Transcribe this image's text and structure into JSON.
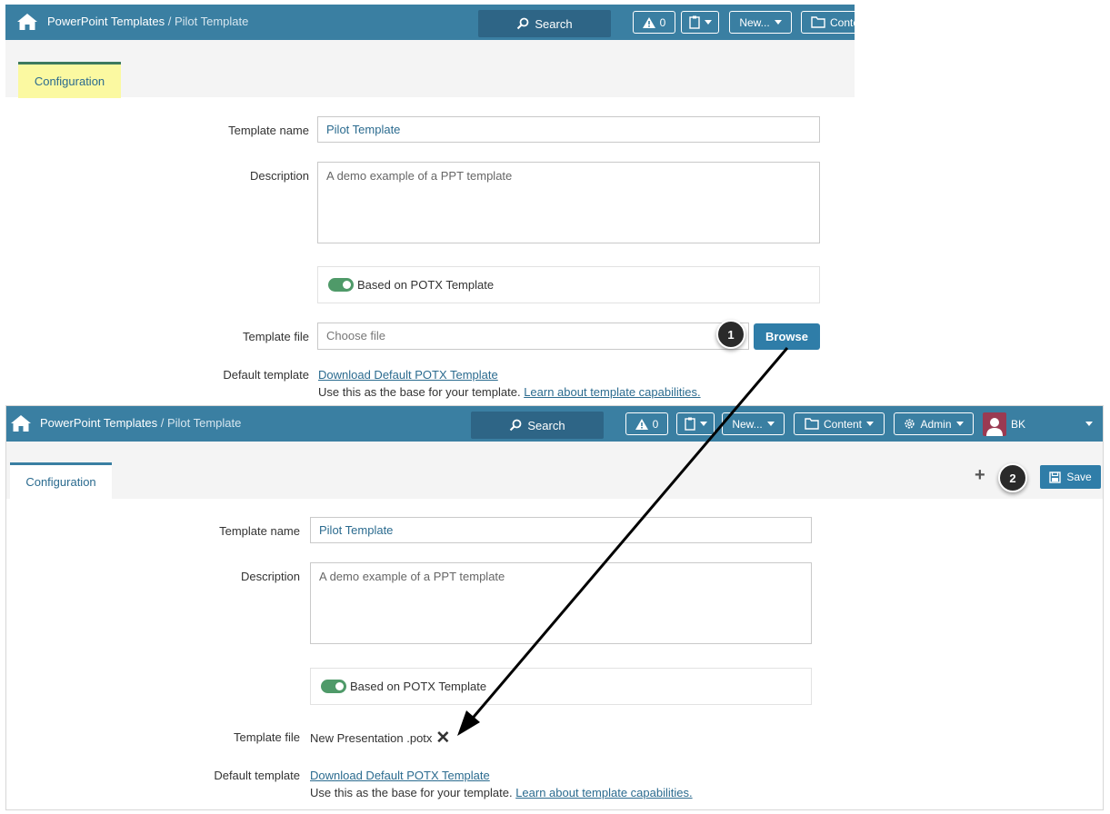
{
  "header": {
    "breadcrumb_root": "PowerPoint Templates",
    "breadcrumb_sep": " / ",
    "breadcrumb_current": "Pilot Template",
    "search_label": "Search",
    "alerts_count": "0",
    "new_label": "New...",
    "content_label": "Content",
    "content_label_truncated": "Conte",
    "admin_label": "Admin",
    "user_initials": "BK"
  },
  "tabs": {
    "configuration": "Configuration"
  },
  "form": {
    "template_name_label": "Template name",
    "template_name_value": "Pilot Template",
    "description_label": "Description",
    "description_value": "A demo example of a PPT template",
    "based_on_potx_label": "Based on POTX Template",
    "template_file_label": "Template file",
    "file_placeholder": "Choose file",
    "browse_label": "Browse",
    "uploaded_file_name": "New Presentation .potx",
    "default_template_label": "Default template",
    "download_link": "Download Default POTX Template",
    "hint_text": "Use this as the base for your template.",
    "learn_link": "Learn about template capabilities."
  },
  "actions": {
    "save_label": "Save"
  },
  "markers": {
    "step1": "1",
    "step2": "2"
  },
  "colors": {
    "header_bg": "#3a7fa2",
    "search_bg": "#2e6586",
    "primary_button": "#2f7da8",
    "tab_highlight": "#fbf9a1",
    "toggle_on": "#4f9a69",
    "avatar_bg": "#9a3a52"
  }
}
